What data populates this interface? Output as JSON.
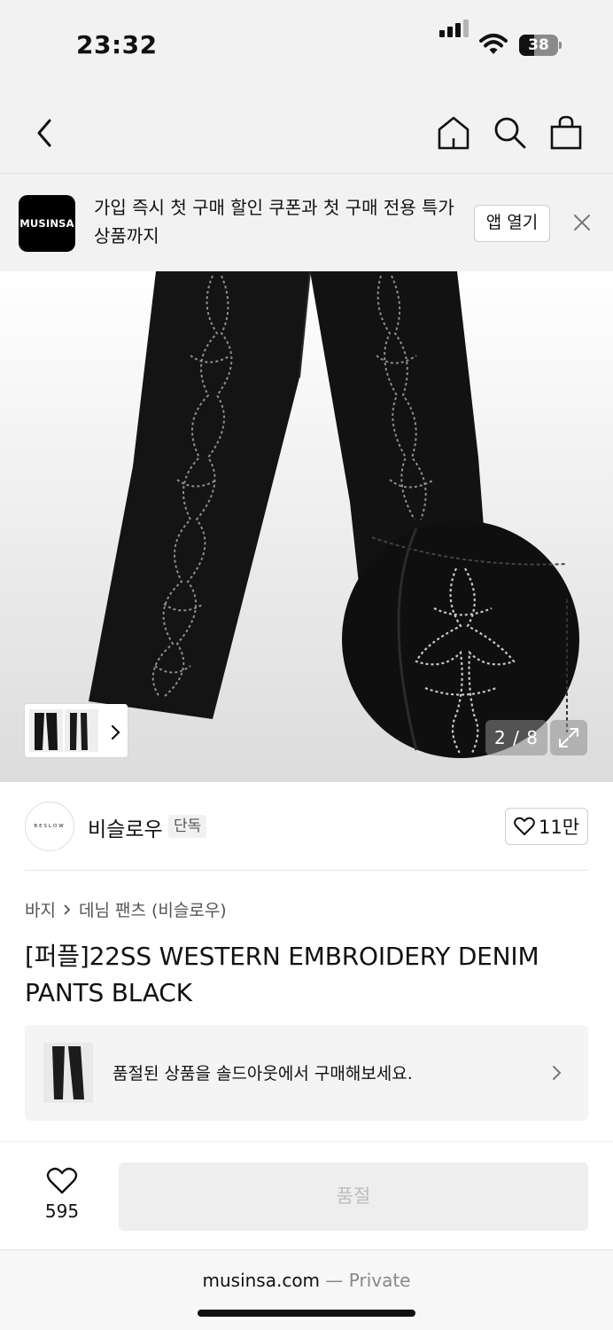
{
  "status_bar": {
    "time": "23:32",
    "battery": "38",
    "battery_level": 0.38
  },
  "nav": {
    "back_icon": "chevron-left-icon",
    "home_icon": "home-icon",
    "search_icon": "search-icon",
    "bag_icon": "shopping-bag-icon"
  },
  "app_banner": {
    "logo_text": "MUSINSA",
    "message": "가입 즉시 첫 구매 할인 쿠폰과 첫 구매 전용 특가 상품까지",
    "open_label": "앱 열기",
    "close_icon": "close-icon"
  },
  "gallery": {
    "counter": "2 / 8",
    "expand_icon": "expand-icon"
  },
  "brand": {
    "logo_text": "BESLOW",
    "name": "비슬로우",
    "badge": "단독",
    "like_count": "11만"
  },
  "breadcrumb": {
    "category": "바지",
    "subcategory": "데님 팬츠 (비슬로우)"
  },
  "product": {
    "title": "[퍼플]22SS WESTERN EMBROIDERY DENIM PANTS BLACK"
  },
  "soldout_banner": {
    "text": "품절된 상품을 솔드아웃에서 구매해보세요."
  },
  "bottom_bar": {
    "like_count": "595",
    "buy_label": "품절"
  },
  "browser": {
    "domain": "musinsa.com",
    "private_label": "— Private"
  },
  "colors": {
    "background": "#f2f2f2",
    "disabled_text": "#bdbdbd",
    "text": "#111111"
  }
}
